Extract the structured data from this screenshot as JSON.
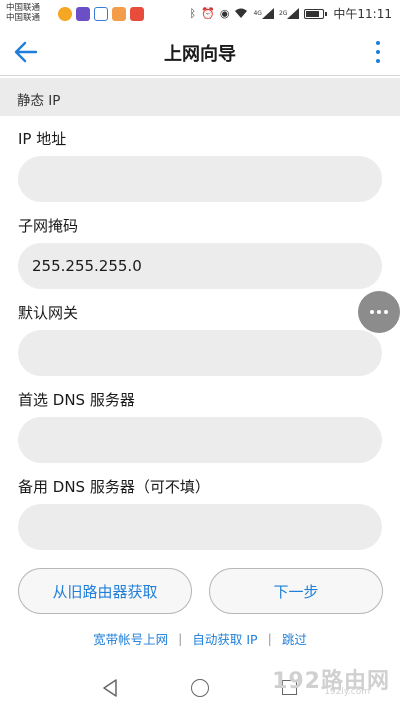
{
  "status_bar": {
    "carrier_1": "中国联通",
    "carrier_2": "中国联通",
    "time": "中午11:11",
    "network_1": "4G",
    "network_2": "2G"
  },
  "header": {
    "title": "上网向导"
  },
  "section": {
    "title": "静态 IP"
  },
  "form": {
    "ip_label": "IP 地址",
    "ip_value": "",
    "mask_label": "子网掩码",
    "mask_value": "255.255.255.0",
    "gateway_label": "默认网关",
    "gateway_value": "",
    "dns1_label": "首选 DNS 服务器",
    "dns1_value": "",
    "dns2_label": "备用 DNS 服务器（可不填）",
    "dns2_value": ""
  },
  "buttons": {
    "fetch_label": "从旧路由器获取",
    "next_label": "下一步"
  },
  "links": {
    "pppoe": "宽带帐号上网",
    "dhcp": "自动获取 IP",
    "skip": "跳过"
  },
  "watermark": {
    "text": "192路由网",
    "sub": "192ly.com"
  },
  "colors": {
    "accent": "#1f7fd8",
    "field_bg": "#ececec",
    "section_bg": "#ebebeb"
  }
}
